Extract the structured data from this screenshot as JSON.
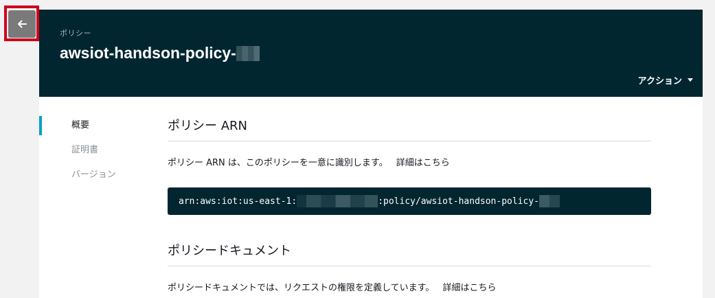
{
  "breadcrumb": "ポリシー",
  "title": "awsiot-handson-policy-",
  "actions_label": "アクション",
  "nav": {
    "items": [
      {
        "label": "概要",
        "active": true
      },
      {
        "label": "証明書",
        "active": false
      },
      {
        "label": "バージョン",
        "active": false
      }
    ]
  },
  "arn_section": {
    "title": "ポリシー ARN",
    "description": "ポリシー ARN は、このポリシーを一意に識別します。",
    "link": "詳細はこちら",
    "arn_prefix": "arn:aws:iot:us-east-1:",
    "arn_middle": ":policy/awsiot-handson-policy-"
  },
  "doc_section": {
    "title": "ポリシードキュメント",
    "description": "ポリシードキュメントでは、リクエストの権限を定義しています。",
    "link": "詳細はこちら"
  },
  "colors": {
    "header_bg": "#022630",
    "accent": "#00a1c9",
    "highlight": "#d0021b"
  }
}
